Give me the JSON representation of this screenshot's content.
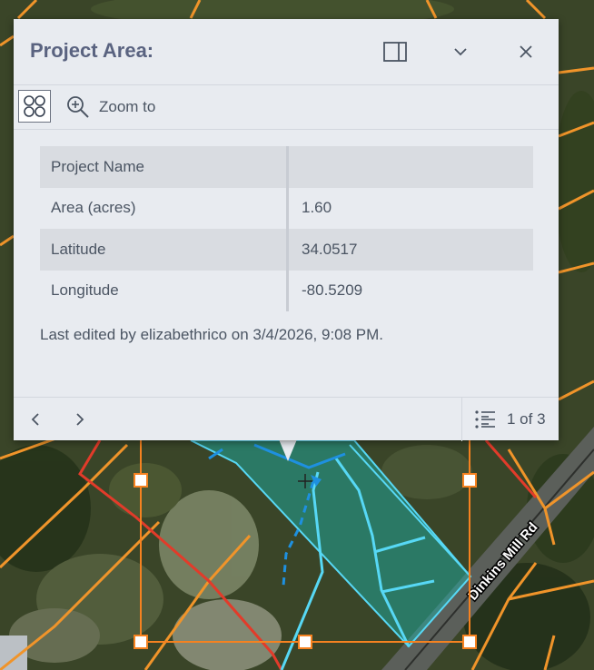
{
  "map": {
    "road_label": "Dinkins Mill Rd"
  },
  "popup": {
    "title": "Project Area:",
    "toolbar": {
      "zoom_label": "Zoom to"
    },
    "fields": [
      {
        "label": "Project Name",
        "value": ""
      },
      {
        "label": "Area (acres)",
        "value": "1.60"
      },
      {
        "label": "Latitude",
        "value": "34.0517"
      },
      {
        "label": "Longitude",
        "value": "-80.5209"
      }
    ],
    "edited_text": "Last edited by elizabethrico on 3/4/2026, 9:08 PM.",
    "pager_text": "1 of 3"
  },
  "icons": {
    "dock": "dock-icon",
    "collapse": "chevron-down-icon",
    "close": "close-icon",
    "features": "feature-menu-icon",
    "zoom": "zoom-in-icon",
    "previous": "chevron-left-icon",
    "next": "chevron-right-icon",
    "list": "list-icon"
  },
  "colors": {
    "parcel_boundary": "#f0942a",
    "selected_boundary": "#e23b2a",
    "project_area_fill": "#1bb7b0",
    "project_area_outline": "#57d8f5",
    "selection_box": "#f58220"
  }
}
